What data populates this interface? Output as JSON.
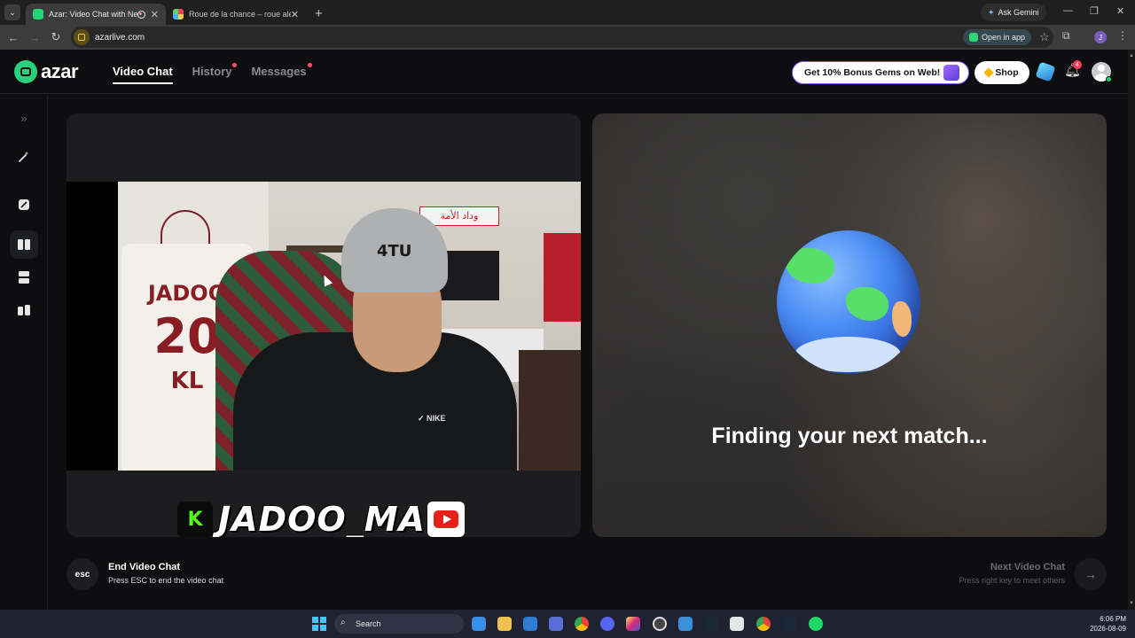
{
  "browser": {
    "tabs": [
      {
        "title": "Azar: Video Chat with New",
        "active": true,
        "favicon_color": "#28d27a"
      },
      {
        "title": "Roue de la chance – roue aléato",
        "active": false,
        "favicon_color": "#e8455c"
      }
    ],
    "ask_gemini": "Ask Gemini",
    "url": "azarlive.com",
    "open_in_app": "Open in app",
    "profile_initial": "J"
  },
  "azar": {
    "logo_text": "azar",
    "nav": [
      {
        "label": "Video Chat",
        "active": true,
        "dot": false
      },
      {
        "label": "History",
        "active": false,
        "dot": true
      },
      {
        "label": "Messages",
        "active": false,
        "dot": true
      }
    ],
    "bonus_label": "Get 10% Bonus Gems on Web!",
    "shop_label": "Shop",
    "notification_count": "4",
    "accent_color": "#28d27a"
  },
  "video": {
    "jersey_name": "JADOO",
    "jersey_number": "20",
    "jersey_initials": "KL",
    "beanie_text": "4TU",
    "banner_text": "وداد الأمة",
    "streamer_handle": "JADOO_MA",
    "kick_letter": "K"
  },
  "match": {
    "status_text": "Finding your next match..."
  },
  "footer": {
    "esc_label": "esc",
    "end_title": "End Video Chat",
    "end_sub": "Press ESC to end the video chat",
    "next_title": "Next Video Chat",
    "next_sub": "Press right key to meet others"
  },
  "taskbar": {
    "search_label": "Search",
    "time": "6:06 PM",
    "date": "2026-08-09"
  }
}
